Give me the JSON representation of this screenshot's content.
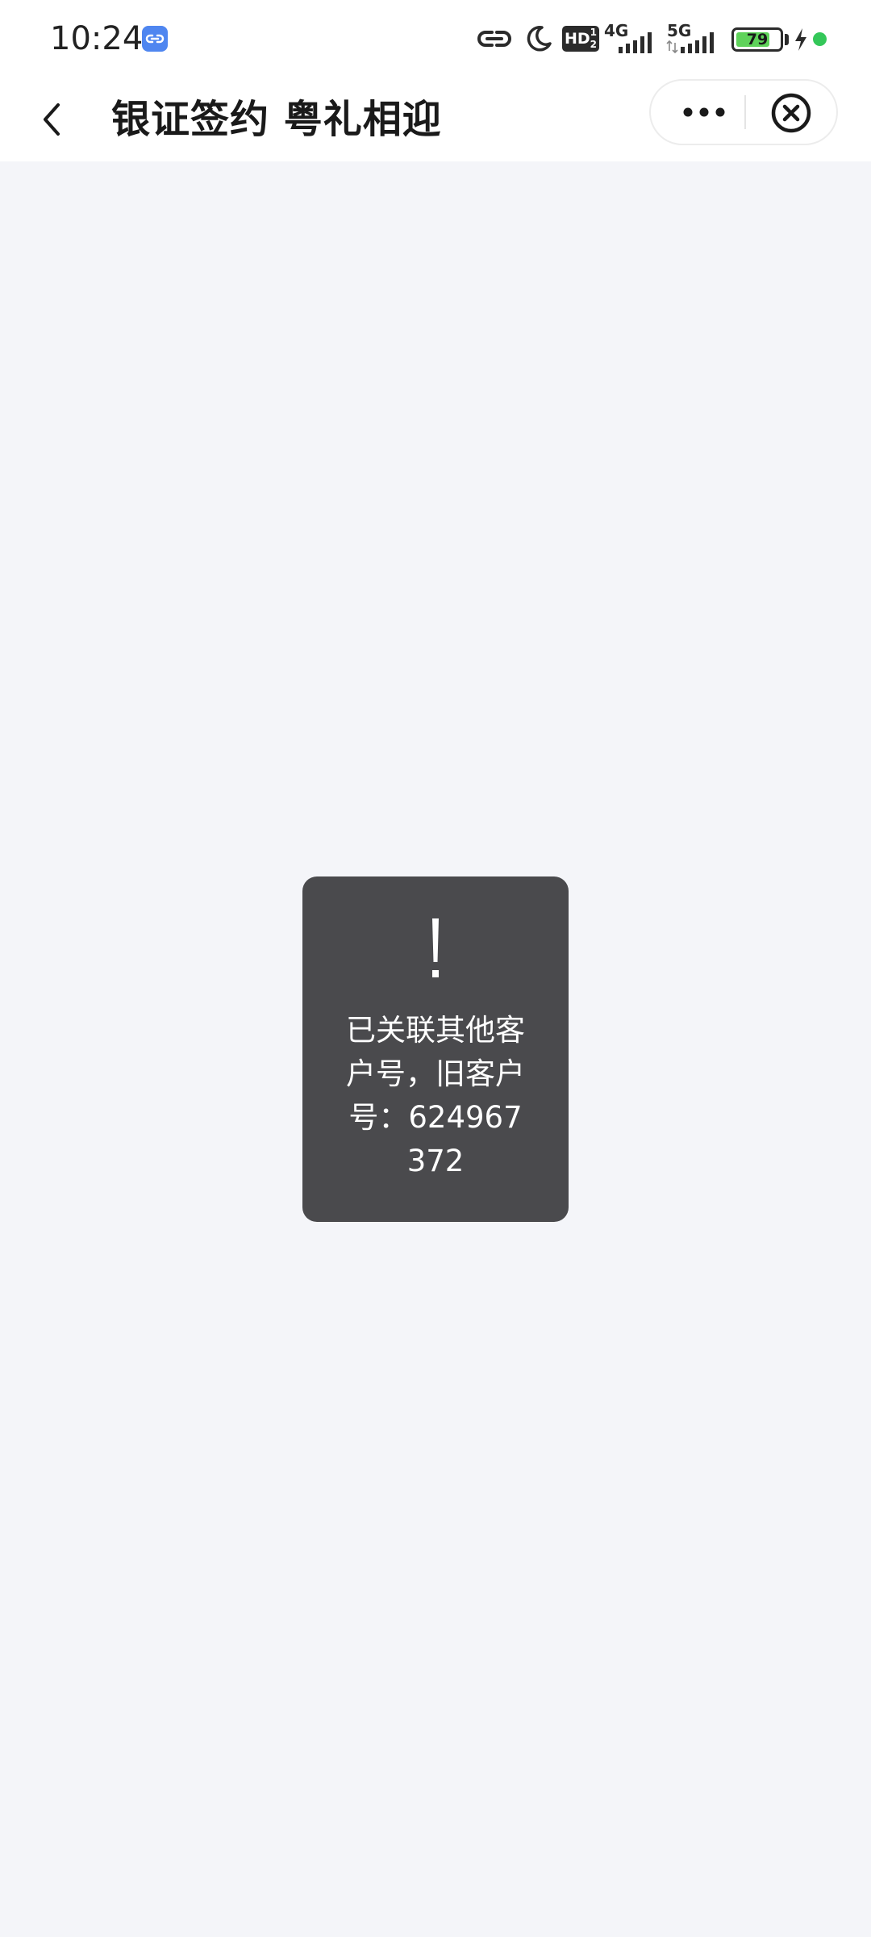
{
  "status_bar": {
    "time": "10:24",
    "network_1": "4G",
    "network_2": "5G",
    "hd_label": "HD",
    "hd_sup": "1",
    "hd_sub": "2",
    "battery_level": "79",
    "battery_fraction": 0.79
  },
  "nav": {
    "title": "银证签约 粤礼相迎"
  },
  "toast": {
    "icon": "exclamation-icon",
    "message": "已关联其他客户号，旧客户号：624967372"
  },
  "colors": {
    "page_background": "#f4f5f9",
    "toast_background": "#4a4a4d",
    "battery_fill": "#5fd35a",
    "app_icon": "#4f86f0",
    "status_dot": "#34c759"
  }
}
